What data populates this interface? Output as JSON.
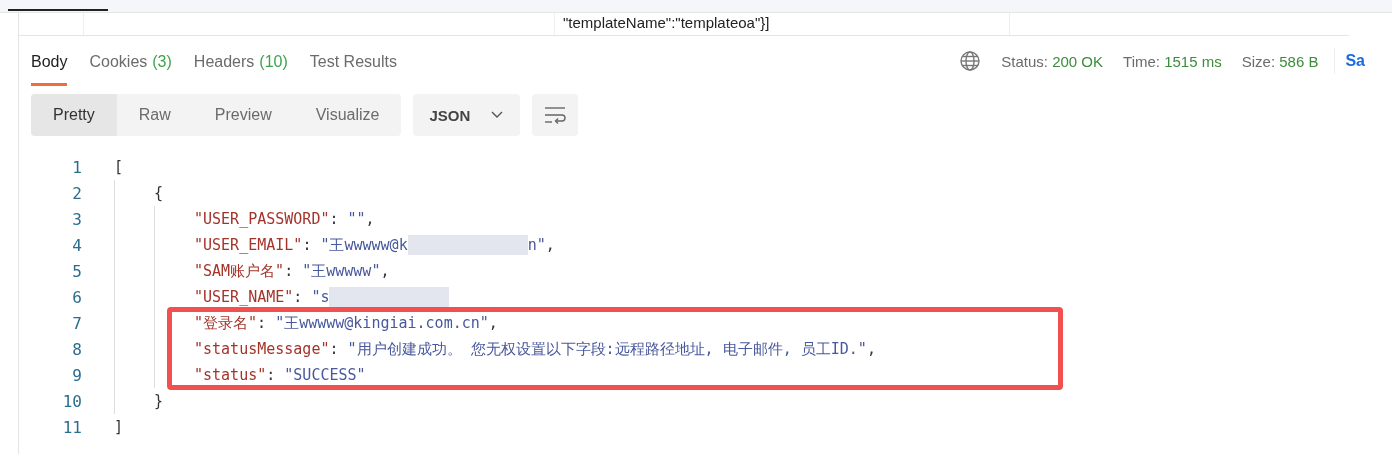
{
  "top_cell": "\"templateName\":\"templateoa\"}]",
  "tabs": [
    {
      "label": "Body",
      "selected": true
    },
    {
      "label": "Cookies",
      "count": "(3)",
      "selected": false
    },
    {
      "label": "Headers",
      "count": "(10)",
      "selected": false
    },
    {
      "label": "Test Results",
      "selected": false
    }
  ],
  "status": {
    "status_label": "Status:",
    "status_value": "200 OK",
    "time_label": "Time:",
    "time_value": "1515 ms",
    "size_label": "Size:",
    "size_value": "586 B",
    "save": "Sa"
  },
  "views": [
    {
      "label": "Pretty",
      "selected": true
    },
    {
      "label": "Raw",
      "selected": false
    },
    {
      "label": "Preview",
      "selected": false
    },
    {
      "label": "Visualize",
      "selected": false
    }
  ],
  "format": "JSON",
  "code": [
    {
      "number": "1",
      "tokens": [
        {
          "kind": "punct",
          "text": "["
        }
      ],
      "children": [
        {
          "number": "2",
          "tokens": [
            {
              "kind": "punct",
              "text": "{"
            }
          ],
          "children": [
            {
              "number": "3",
              "tokens": [
                {
                  "kind": "key",
                  "text": "\"USER_PASSWORD\""
                },
                {
                  "kind": "punct",
                  "text": ": "
                },
                {
                  "kind": "string",
                  "text": "\"\""
                },
                {
                  "kind": "punct",
                  "text": ","
                }
              ]
            },
            {
              "number": "4",
              "tokens": [
                {
                  "kind": "key",
                  "text": "\"USER_EMAIL\""
                },
                {
                  "kind": "punct",
                  "text": ": "
                },
                {
                  "kind": "string",
                  "text": "\"王wwwww@k"
                },
                {
                  "kind": "redacted"
                },
                {
                  "kind": "string",
                  "text": "n\""
                },
                {
                  "kind": "punct",
                  "text": ","
                }
              ]
            },
            {
              "number": "5",
              "tokens": [
                {
                  "kind": "key",
                  "text": "\"SAM账户名\""
                },
                {
                  "kind": "punct",
                  "text": ": "
                },
                {
                  "kind": "string",
                  "text": "\"王wwwww\""
                },
                {
                  "kind": "punct",
                  "text": ","
                }
              ]
            },
            {
              "number": "6",
              "tokens": [
                {
                  "kind": "key",
                  "text": "\"USER_NAME\""
                },
                {
                  "kind": "punct",
                  "text": ": "
                },
                {
                  "kind": "string",
                  "text": "\"s"
                },
                {
                  "kind": "redacted"
                }
              ]
            },
            {
              "number": "7",
              "tokens": [
                {
                  "kind": "key",
                  "text": "\"登录名\""
                },
                {
                  "kind": "punct",
                  "text": ": "
                },
                {
                  "kind": "string",
                  "text": "\"王wwwww@kingiai.com.cn\""
                },
                {
                  "kind": "punct",
                  "text": ","
                }
              ]
            },
            {
              "number": "8",
              "tokens": [
                {
                  "kind": "key",
                  "text": "\"statusMessage\""
                },
                {
                  "kind": "punct",
                  "text": ": "
                },
                {
                  "kind": "string",
                  "text": "\"用户创建成功。 您无权设置以下字段:远程路径地址, 电子邮件, 员工ID.\""
                },
                {
                  "kind": "punct",
                  "text": ","
                }
              ]
            },
            {
              "number": "9",
              "tokens": [
                {
                  "kind": "key",
                  "text": "\"status\""
                },
                {
                  "kind": "punct",
                  "text": ": "
                },
                {
                  "kind": "string",
                  "text": "\"SUCCESS\""
                }
              ]
            }
          ]
        },
        {
          "number": "10",
          "tokens": [
            {
              "kind": "punct",
              "text": "}"
            }
          ]
        }
      ]
    },
    {
      "number": "11",
      "tokens": [
        {
          "kind": "punct",
          "text": "]"
        }
      ]
    }
  ]
}
